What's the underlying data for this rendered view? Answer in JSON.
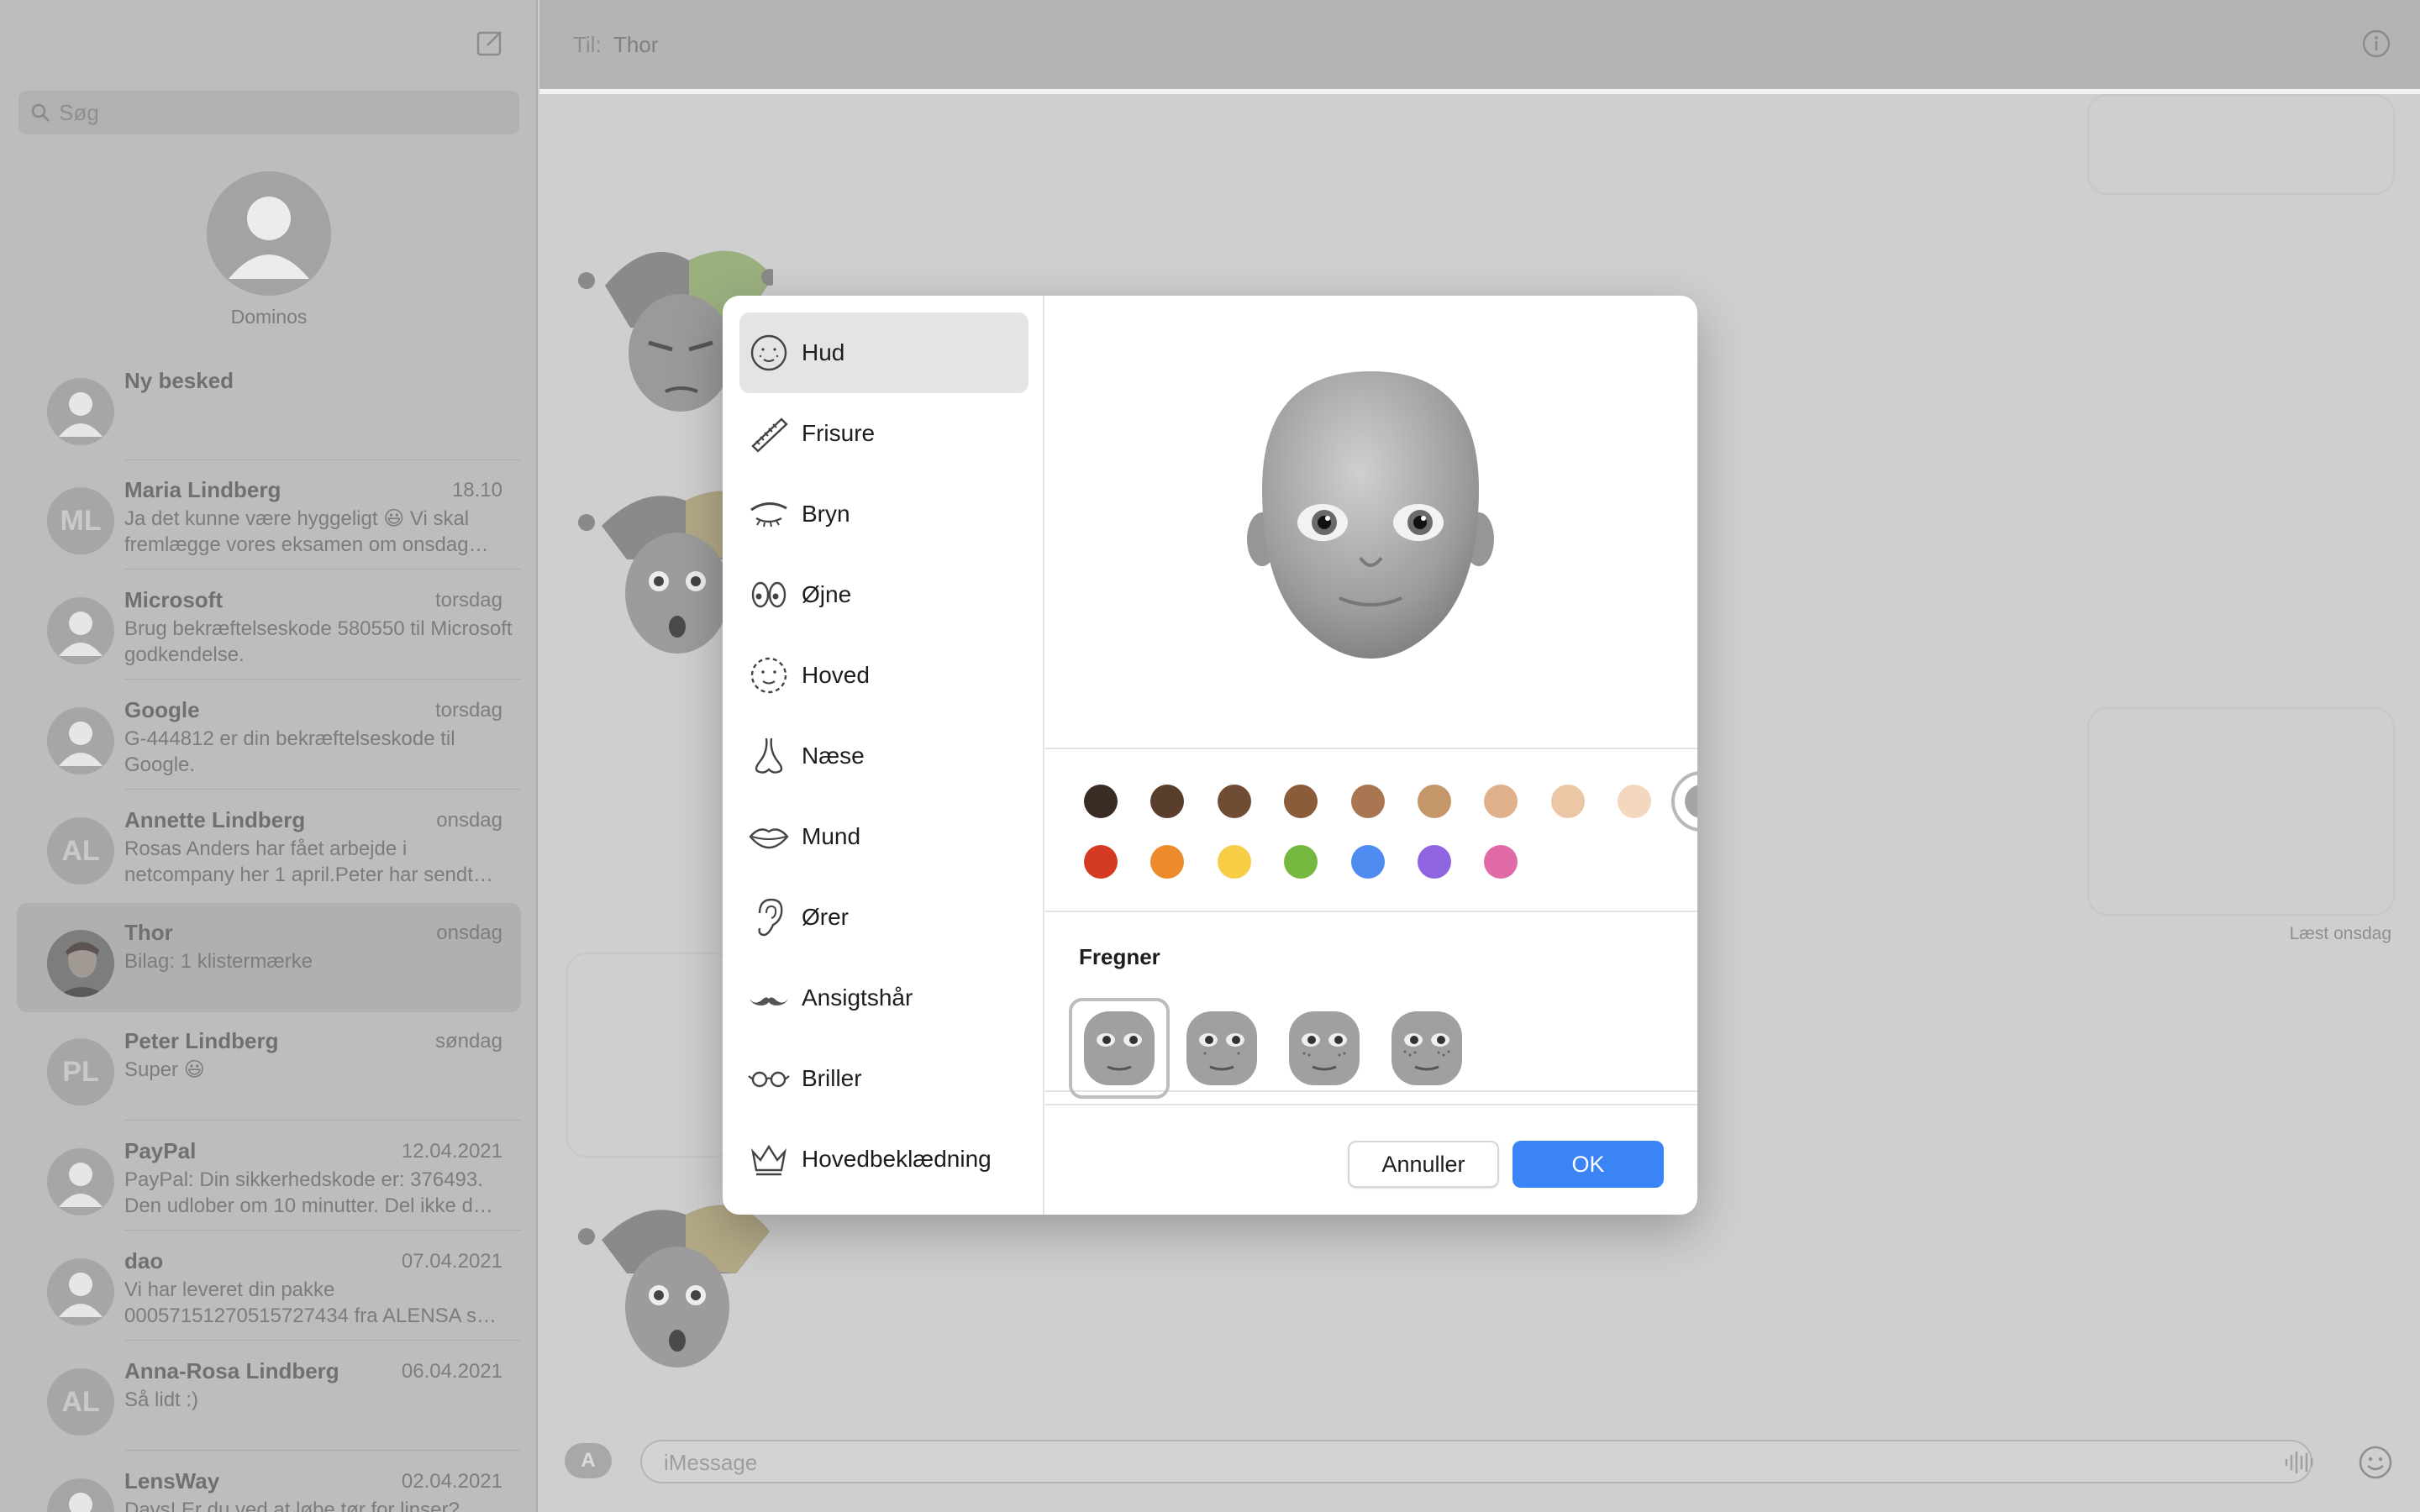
{
  "sidebar": {
    "search_placeholder": "Søg",
    "pinned": {
      "name": "Dominos"
    },
    "conversations": [
      {
        "name": "Ny besked",
        "date": "",
        "preview": "",
        "initials": ""
      },
      {
        "name": "Maria Lindberg",
        "date": "18.10",
        "preview": "Ja det kunne være hyggeligt 😃 Vi skal fremlægge vores eksamen om onsdag…",
        "initials": "ML"
      },
      {
        "name": "Microsoft",
        "date": "torsdag",
        "preview": "Brug bekræftelseskode 580550 til Microsoft godkendelse.",
        "initials": ""
      },
      {
        "name": "Google",
        "date": "torsdag",
        "preview": "G-444812 er din bekræftelseskode til Google.",
        "initials": ""
      },
      {
        "name": "Annette Lindberg",
        "date": "onsdag",
        "preview": "Rosas Anders har fået arbejde i netcompany her 1 april.Peter har sendt…",
        "initials": "AL"
      },
      {
        "name": "Thor",
        "date": "onsdag",
        "preview": "Bilag: 1 klistermærke",
        "initials": ""
      },
      {
        "name": "Peter Lindberg",
        "date": "søndag",
        "preview": "Super 😃",
        "initials": "PL"
      },
      {
        "name": "PayPal",
        "date": "12.04.2021",
        "preview": "PayPal: Din sikkerhedskode er: 376493. Den udlober om 10 minutter. Del ikke d…",
        "initials": ""
      },
      {
        "name": "dao",
        "date": "07.04.2021",
        "preview": "Vi har leveret din pakke 00057151270515727434 fra ALENSA s…",
        "initials": ""
      },
      {
        "name": "Anna-Rosa Lindberg",
        "date": "06.04.2021",
        "preview": "Så lidt :)",
        "initials": "AL"
      },
      {
        "name": "LensWay",
        "date": "02.04.2021",
        "preview": "Davs! Er du ved at løbe tør for linser?",
        "initials": ""
      }
    ]
  },
  "header": {
    "to_label": "Til:",
    "recipient": "Thor"
  },
  "thread": {
    "read_status": "Læst onsdag"
  },
  "composer": {
    "placeholder": "iMessage"
  },
  "modal": {
    "categories": [
      {
        "label": "Hud",
        "icon": "skin-icon",
        "active": true
      },
      {
        "label": "Frisure",
        "icon": "comb-icon"
      },
      {
        "label": "Bryn",
        "icon": "eyebrow-icon"
      },
      {
        "label": "Øjne",
        "icon": "eyes-icon"
      },
      {
        "label": "Hoved",
        "icon": "head-icon"
      },
      {
        "label": "Næse",
        "icon": "nose-icon"
      },
      {
        "label": "Mund",
        "icon": "mouth-icon"
      },
      {
        "label": "Ører",
        "icon": "ear-icon"
      },
      {
        "label": "Ansigtshår",
        "icon": "mustache-icon"
      },
      {
        "label": "Briller",
        "icon": "glasses-icon"
      },
      {
        "label": "Hovedbeklædning",
        "icon": "crown-icon"
      }
    ],
    "skin_colors": [
      "#3a2b24",
      "#5a3e2c",
      "#6f4c33",
      "#8a5c3a",
      "#a97652",
      "#c6966b",
      "#dfb08a",
      "#ecc7a6",
      "#f3d7bf",
      "#a5a5a5"
    ],
    "fantasy_colors": [
      "#d33a21",
      "#ec8a2c",
      "#f6cd45",
      "#74b83f",
      "#4e8def",
      "#8f64e0",
      "#df6aa6"
    ],
    "selected_color_index": 9,
    "freckles_title": "Fregner",
    "cancel_label": "Annuller",
    "ok_label": "OK"
  }
}
